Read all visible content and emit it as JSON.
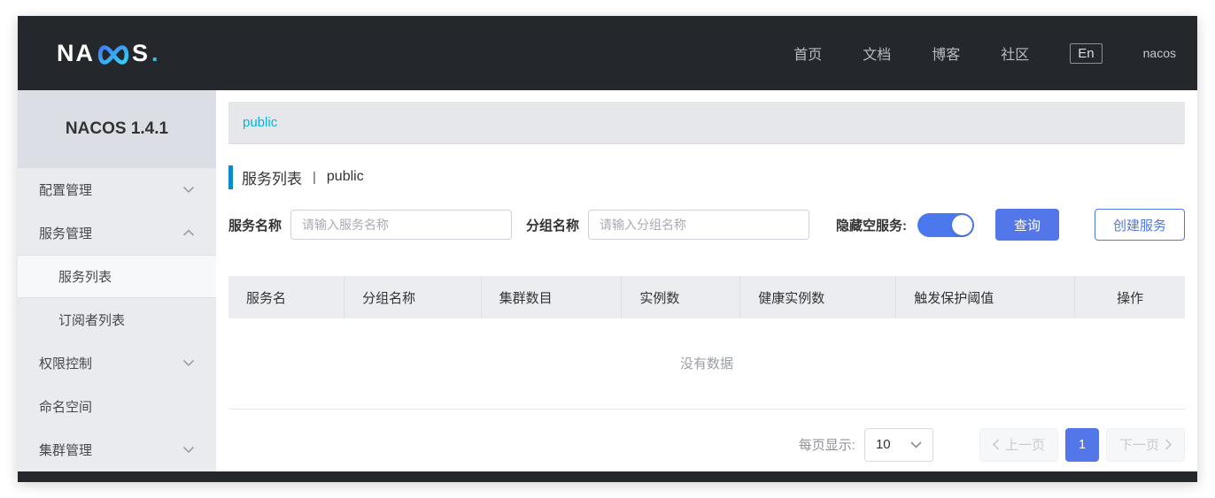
{
  "navbar": {
    "logo_part1": "NA",
    "logo_part2": "S",
    "logo_dot": ".",
    "items": [
      "首页",
      "文档",
      "博客",
      "社区"
    ],
    "lang": "En",
    "username": "nacos"
  },
  "sidebar": {
    "version": "NACOS 1.4.1",
    "items": [
      {
        "label": "配置管理",
        "chevron": "down"
      },
      {
        "label": "服务管理",
        "chevron": "up"
      },
      {
        "label": "服务列表",
        "sub": true,
        "selected": true
      },
      {
        "label": "订阅者列表",
        "sub": true
      },
      {
        "label": "权限控制",
        "chevron": "down"
      },
      {
        "label": "命名空间",
        "chevron": "none"
      },
      {
        "label": "集群管理",
        "chevron": "down"
      }
    ]
  },
  "main": {
    "namespace_tab": "public",
    "title": "服务列表",
    "title_separator": "|",
    "title_namespace": "public",
    "filters": {
      "service_name_label": "服务名称",
      "service_name_placeholder": "请输入服务名称",
      "service_name_value": "",
      "group_name_label": "分组名称",
      "group_name_placeholder": "请输入分组名称",
      "group_name_value": "",
      "hide_empty_label": "隐藏空服务:",
      "hide_empty_on": true,
      "search_button": "查询",
      "create_button": "创建服务"
    },
    "table": {
      "columns": [
        "服务名",
        "分组名称",
        "集群数目",
        "实例数",
        "健康实例数",
        "触发保护阈值",
        "操作"
      ],
      "empty_text": "没有数据"
    },
    "pagination": {
      "page_size_label": "每页显示:",
      "page_size": "10",
      "prev_label": "上一页",
      "current_page": "1",
      "next_label": "下一页"
    }
  },
  "colors": {
    "navbar_bg": "#24272c",
    "accent_blue": "#5377e8",
    "toggle_blue": "#4c78ee",
    "tab_cyan": "#06b3dc",
    "title_bar_blue": "#0e88cf",
    "sidebar_bg": "#e9ebef",
    "sidebar_head_bg": "#dbdee4",
    "table_head_bg": "#ebedf0"
  }
}
